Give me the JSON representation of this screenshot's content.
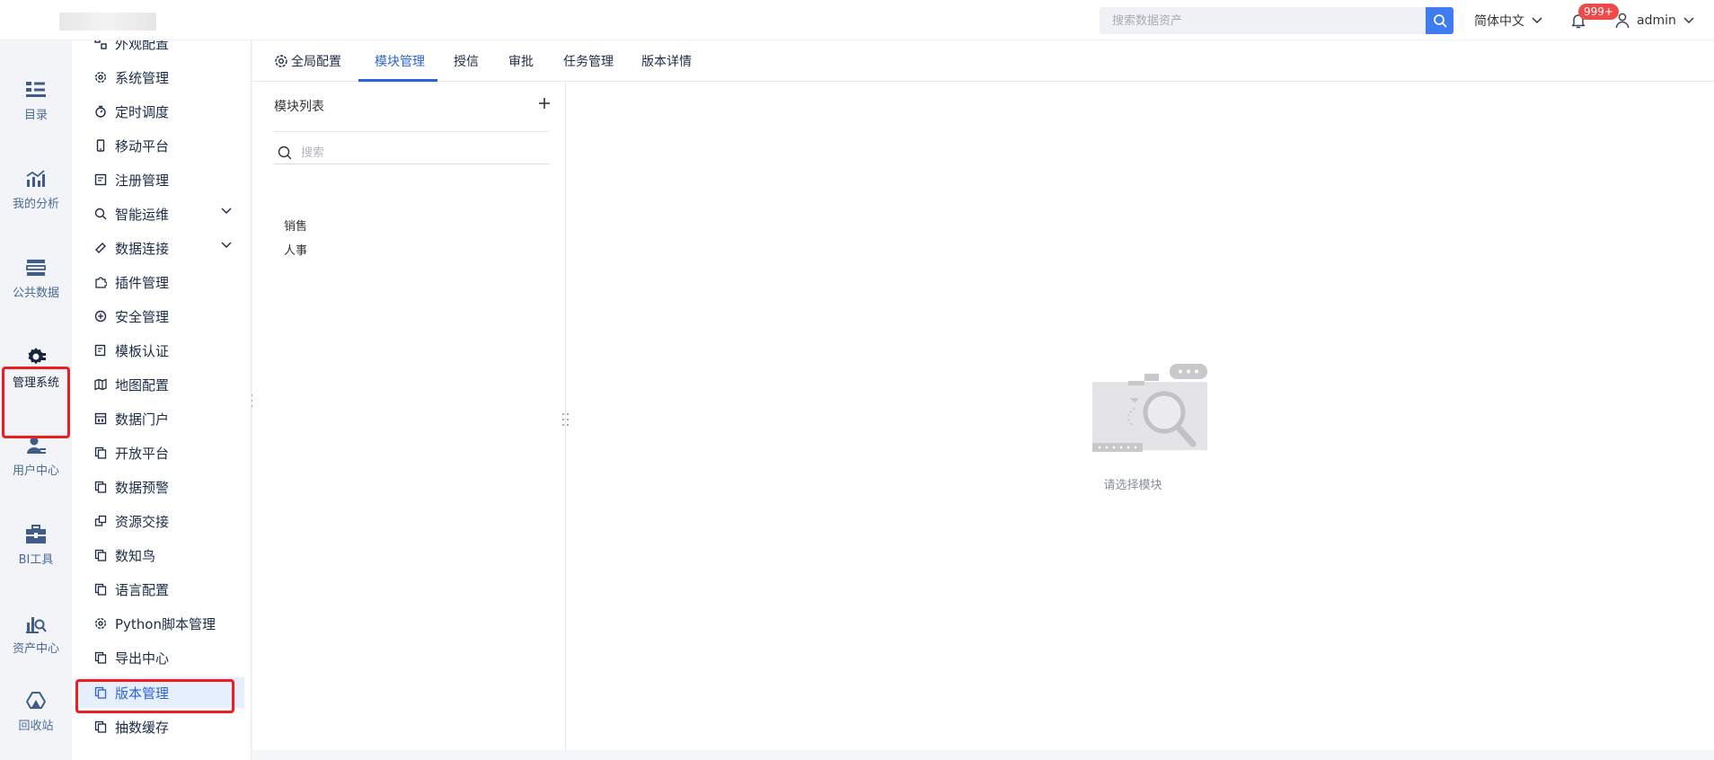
{
  "header": {
    "search_placeholder": "搜索数据资产",
    "language": "简体中文",
    "notification_badge": "999+",
    "username": "admin"
  },
  "rail": {
    "items": [
      {
        "label": "目录",
        "icon": "catalog-icon"
      },
      {
        "label": "我的分析",
        "icon": "analysis-icon"
      },
      {
        "label": "公共数据",
        "icon": "public-data-icon"
      },
      {
        "label": "管理系统",
        "icon": "gear-icon",
        "active": true
      },
      {
        "label": "用户中心",
        "icon": "user-center-icon"
      },
      {
        "label": "BI工具",
        "icon": "toolbox-icon"
      },
      {
        "label": "资产中心",
        "icon": "asset-icon"
      },
      {
        "label": "回收站",
        "icon": "recycle-icon"
      }
    ]
  },
  "submenu": {
    "items": [
      {
        "label": "外观配置"
      },
      {
        "label": "系统管理"
      },
      {
        "label": "定时调度"
      },
      {
        "label": "移动平台"
      },
      {
        "label": "注册管理"
      },
      {
        "label": "智能运维",
        "expandable": true
      },
      {
        "label": "数据连接",
        "expandable": true
      },
      {
        "label": "插件管理"
      },
      {
        "label": "安全管理"
      },
      {
        "label": "模板认证"
      },
      {
        "label": "地图配置"
      },
      {
        "label": "数据门户"
      },
      {
        "label": "开放平台"
      },
      {
        "label": "数据预警"
      },
      {
        "label": "资源交接"
      },
      {
        "label": "数知鸟"
      },
      {
        "label": "语言配置"
      },
      {
        "label": "Python脚本管理"
      },
      {
        "label": "导出中心"
      },
      {
        "label": "版本管理",
        "active": true
      },
      {
        "label": "抽数缓存"
      }
    ]
  },
  "tabs": [
    {
      "label": "全局配置"
    },
    {
      "label": "模块管理",
      "active": true
    },
    {
      "label": "授信"
    },
    {
      "label": "审批"
    },
    {
      "label": "任务管理"
    },
    {
      "label": "版本详情"
    }
  ],
  "module_panel": {
    "title": "模块列表",
    "search_placeholder": "搜索",
    "modules": [
      "销售",
      "人事"
    ]
  },
  "empty_state": {
    "text": "请选择模块"
  },
  "colors": {
    "accent": "#2d63d8",
    "search_button": "#3f7cf2",
    "highlight": "#ef1d1d",
    "badge": "#ef4a4a"
  }
}
